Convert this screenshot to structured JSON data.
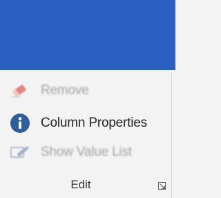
{
  "colors": {
    "titlebar": "#2b5fc0",
    "ribbon_bg": "#f3f3f3",
    "info_icon": "#2f5e9d",
    "eraser_red": "#e05a4a",
    "disabled_text": "#a4a4a4"
  },
  "edit_group": {
    "label": "Edit",
    "commands": [
      {
        "label": "Remove",
        "icon": "eraser-icon",
        "enabled": false
      },
      {
        "label": "Column Properties",
        "icon": "info-icon",
        "enabled": true
      },
      {
        "label": "Show Value List",
        "icon": "edit-list-icon",
        "enabled": false
      }
    ],
    "launcher_icon": "dialog-launcher-icon"
  }
}
